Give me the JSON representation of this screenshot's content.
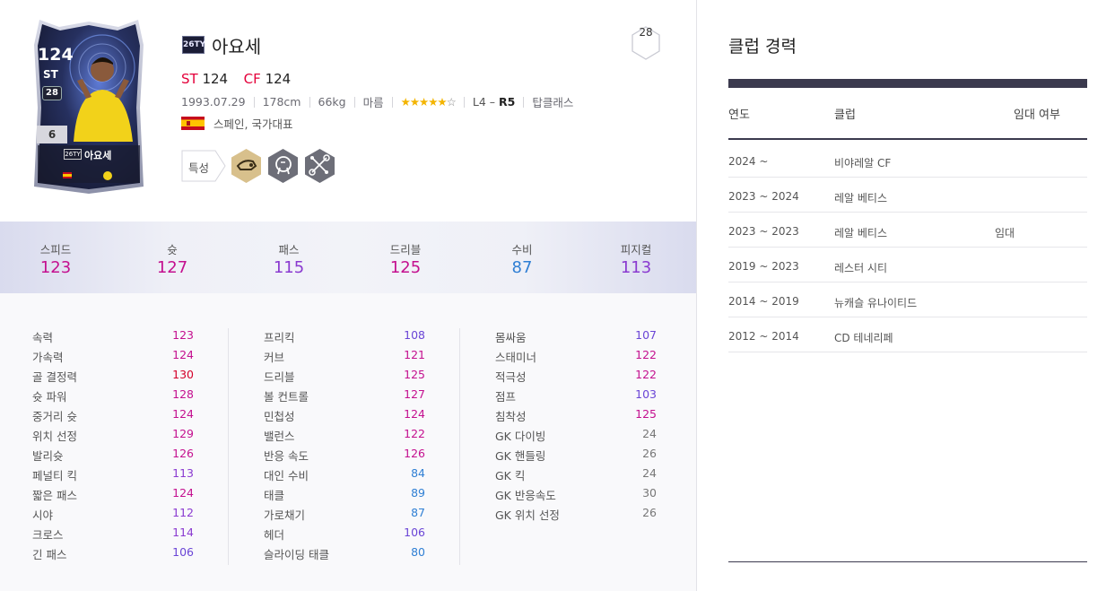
{
  "player": {
    "season_badge": "26TY",
    "name": "아요세",
    "level_badge": "28",
    "positions": [
      {
        "pos": "ST",
        "ovr": "124"
      },
      {
        "pos": "CF",
        "ovr": "124"
      }
    ],
    "birth": "1993.07.29",
    "height": "178cm",
    "weight": "66kg",
    "body_type": "마름",
    "skill_stars": "★★★★★",
    "skill_stars_off": "☆",
    "weak_foot_left": "L4 – ",
    "weak_foot_right": "R5",
    "reputation": "탑클래스",
    "nation": "스페인, 국가대표",
    "traits_label": "특성",
    "trait_icons": [
      "trait-finesse-icon",
      "trait-leader-icon",
      "trait-tactics-icon"
    ],
    "accent_color": "#e4003a"
  },
  "card": {
    "ovr": "124",
    "pos": "ST",
    "grade": "28",
    "enhance": "6",
    "name": "아요세",
    "season": "26TY"
  },
  "summary_stats": [
    {
      "label": "스피드",
      "value": "123",
      "color": "#c4108f"
    },
    {
      "label": "슛",
      "value": "127",
      "color": "#c4108f"
    },
    {
      "label": "패스",
      "value": "115",
      "color": "#8a3ad0"
    },
    {
      "label": "드리블",
      "value": "125",
      "color": "#c4108f"
    },
    {
      "label": "수비",
      "value": "87",
      "color": "#2f7fd4"
    },
    {
      "label": "피지컬",
      "value": "113",
      "color": "#8a3ad0"
    }
  ],
  "detail_stats": [
    [
      {
        "k": "속력",
        "v": "123",
        "c": "#c4108f"
      },
      {
        "k": "가속력",
        "v": "124",
        "c": "#c4108f"
      },
      {
        "k": "골 결정력",
        "v": "130",
        "c": "#d4002a"
      },
      {
        "k": "슛 파워",
        "v": "128",
        "c": "#c4108f"
      },
      {
        "k": "중거리 슛",
        "v": "124",
        "c": "#c4108f"
      },
      {
        "k": "위치 선정",
        "v": "129",
        "c": "#c4108f"
      },
      {
        "k": "발리슛",
        "v": "126",
        "c": "#c4108f"
      },
      {
        "k": "페널티 킥",
        "v": "113",
        "c": "#8a3ad0"
      },
      {
        "k": "짧은 패스",
        "v": "124",
        "c": "#c4108f"
      },
      {
        "k": "시야",
        "v": "112",
        "c": "#8a3ad0"
      },
      {
        "k": "크로스",
        "v": "114",
        "c": "#8a3ad0"
      },
      {
        "k": "긴 패스",
        "v": "106",
        "c": "#6a45d6"
      }
    ],
    [
      {
        "k": "프리킥",
        "v": "108",
        "c": "#6a45d6"
      },
      {
        "k": "커브",
        "v": "121",
        "c": "#c4108f"
      },
      {
        "k": "드리블",
        "v": "125",
        "c": "#c4108f"
      },
      {
        "k": "볼 컨트롤",
        "v": "127",
        "c": "#c4108f"
      },
      {
        "k": "민첩성",
        "v": "124",
        "c": "#c4108f"
      },
      {
        "k": "밸런스",
        "v": "122",
        "c": "#c4108f"
      },
      {
        "k": "반응 속도",
        "v": "126",
        "c": "#c4108f"
      },
      {
        "k": "대인 수비",
        "v": "84",
        "c": "#2f7fd4"
      },
      {
        "k": "태클",
        "v": "89",
        "c": "#2f7fd4"
      },
      {
        "k": "가로채기",
        "v": "87",
        "c": "#2f7fd4"
      },
      {
        "k": "헤더",
        "v": "106",
        "c": "#6a45d6"
      },
      {
        "k": "슬라이딩 태클",
        "v": "80",
        "c": "#2f7fd4"
      }
    ],
    [
      {
        "k": "몸싸움",
        "v": "107",
        "c": "#6a45d6"
      },
      {
        "k": "스태미너",
        "v": "122",
        "c": "#c4108f"
      },
      {
        "k": "적극성",
        "v": "122",
        "c": "#c4108f"
      },
      {
        "k": "점프",
        "v": "103",
        "c": "#6a45d6"
      },
      {
        "k": "침착성",
        "v": "125",
        "c": "#c4108f"
      },
      {
        "k": "GK 다이빙",
        "v": "24",
        "c": "#777777"
      },
      {
        "k": "GK 핸들링",
        "v": "26",
        "c": "#777777"
      },
      {
        "k": "GK 킥",
        "v": "24",
        "c": "#777777"
      },
      {
        "k": "GK 반응속도",
        "v": "30",
        "c": "#777777"
      },
      {
        "k": "GK 위치 선정",
        "v": "26",
        "c": "#777777"
      }
    ]
  ],
  "career": {
    "title": "클럽 경력",
    "headers": {
      "year": "연도",
      "club": "클럽",
      "loan": "임대 여부"
    },
    "rows": [
      {
        "year": "2024 ~",
        "club": "비야레알 CF",
        "loan": ""
      },
      {
        "year": "2023 ~ 2024",
        "club": "레알 베티스",
        "loan": ""
      },
      {
        "year": "2023 ~ 2023",
        "club": "레알 베티스",
        "loan": "임대"
      },
      {
        "year": "2019 ~ 2023",
        "club": "레스터 시티",
        "loan": ""
      },
      {
        "year": "2014 ~ 2019",
        "club": "뉴캐슬 유나이티드",
        "loan": ""
      },
      {
        "year": "2012 ~ 2014",
        "club": "CD 테네리페",
        "loan": ""
      }
    ]
  }
}
